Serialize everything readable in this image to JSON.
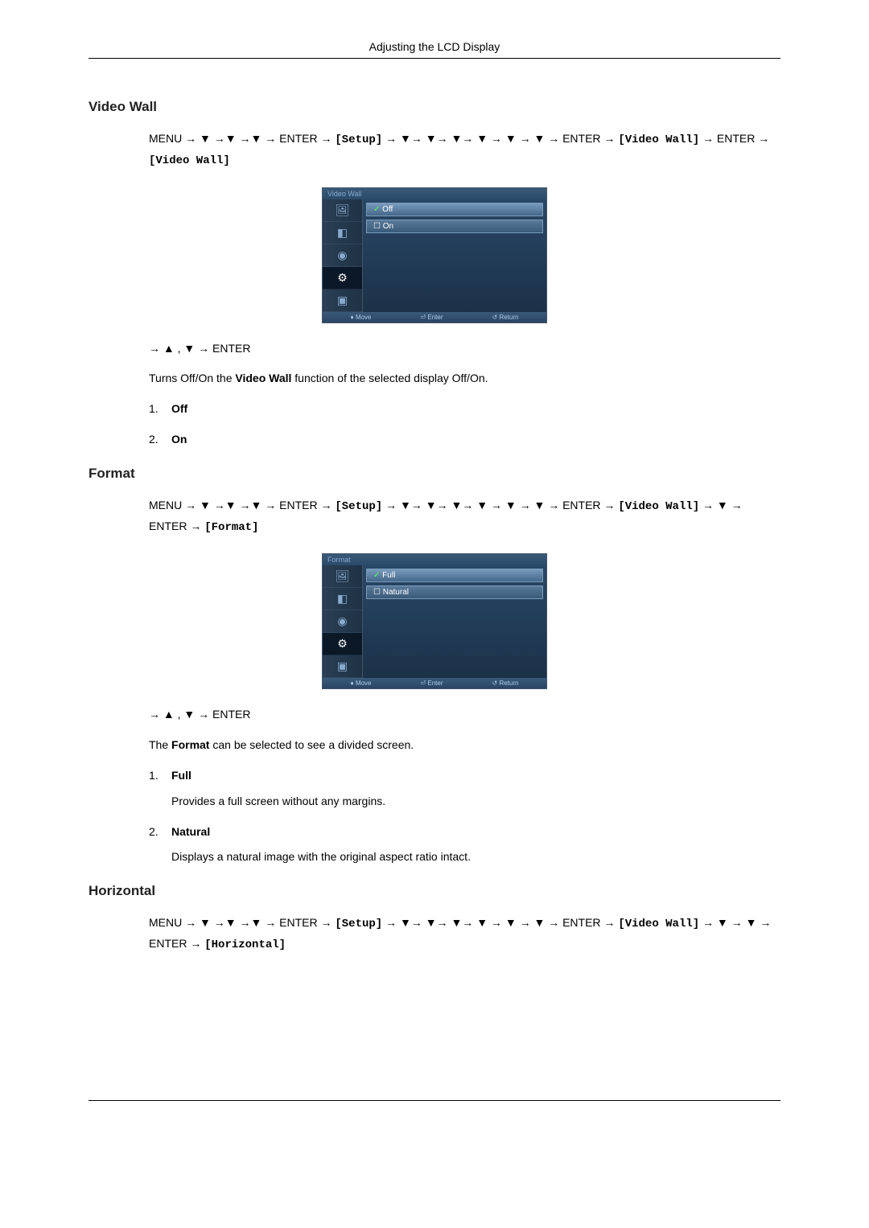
{
  "header": {
    "title": "Adjusting the LCD Display"
  },
  "sections": {
    "videoWall": {
      "heading": "Video Wall",
      "navPath1": "MENU → ▼ →▼ →▼ → ENTER → ",
      "navSetup": "[Setup]",
      "navPath2": " → ▼→ ▼→ ▼→ ▼ → ▼ → ▼ → ENTER → ",
      "navVW1": "[Video Wall]",
      "navPath3": " → ENTER → ",
      "navVW2": "[Video Wall]",
      "osd": {
        "title": "Video Wall",
        "opt1": "Off",
        "opt2": "On",
        "footerMove": "♦ Move",
        "footerEnter": "⏎ Enter",
        "footerReturn": "↺ Return"
      },
      "navAfter": "→ ▲ , ▼ → ENTER",
      "descPrefix": "Turns Off/On the ",
      "descBold": "Video Wall",
      "descSuffix": " function of the selected display Off/On.",
      "list": {
        "n1": "1.",
        "l1": "Off",
        "n2": "2.",
        "l2": "On"
      }
    },
    "format": {
      "heading": "Format",
      "navPath1": "MENU → ▼ →▼ →▼ → ENTER → ",
      "navSetup": "[Setup]",
      "navPath2": " → ▼→ ▼→ ▼→ ▼ → ▼ → ▼ → ENTER → ",
      "navVW1": "[Video Wall]",
      "navPath3": " → ▼ → ENTER → ",
      "navFormat": "[Format]",
      "osd": {
        "title": "Format",
        "opt1": "Full",
        "opt2": "Natural",
        "footerMove": "♦ Move",
        "footerEnter": "⏎ Enter",
        "footerReturn": "↺ Return"
      },
      "navAfter": "→ ▲ , ▼ → ENTER",
      "descPrefix": "The ",
      "descBold": "Format",
      "descSuffix": " can be selected to see a divided screen.",
      "list": {
        "n1": "1.",
        "l1": "Full",
        "d1": "Provides a full screen without any margins.",
        "n2": "2.",
        "l2": "Natural",
        "d2": "Displays a natural image with the original aspect ratio intact."
      }
    },
    "horizontal": {
      "heading": "Horizontal",
      "navPath1": "MENU → ▼ →▼ →▼ → ENTER → ",
      "navSetup": "[Setup]",
      "navPath2": " → ▼→ ▼→ ▼→ ▼ → ▼ → ▼ → ENTER → ",
      "navVW1": "[Video Wall]",
      "navPath3": " → ▼ → ▼ → ENTER → ",
      "navHorizontal": "[Horizontal]"
    }
  }
}
